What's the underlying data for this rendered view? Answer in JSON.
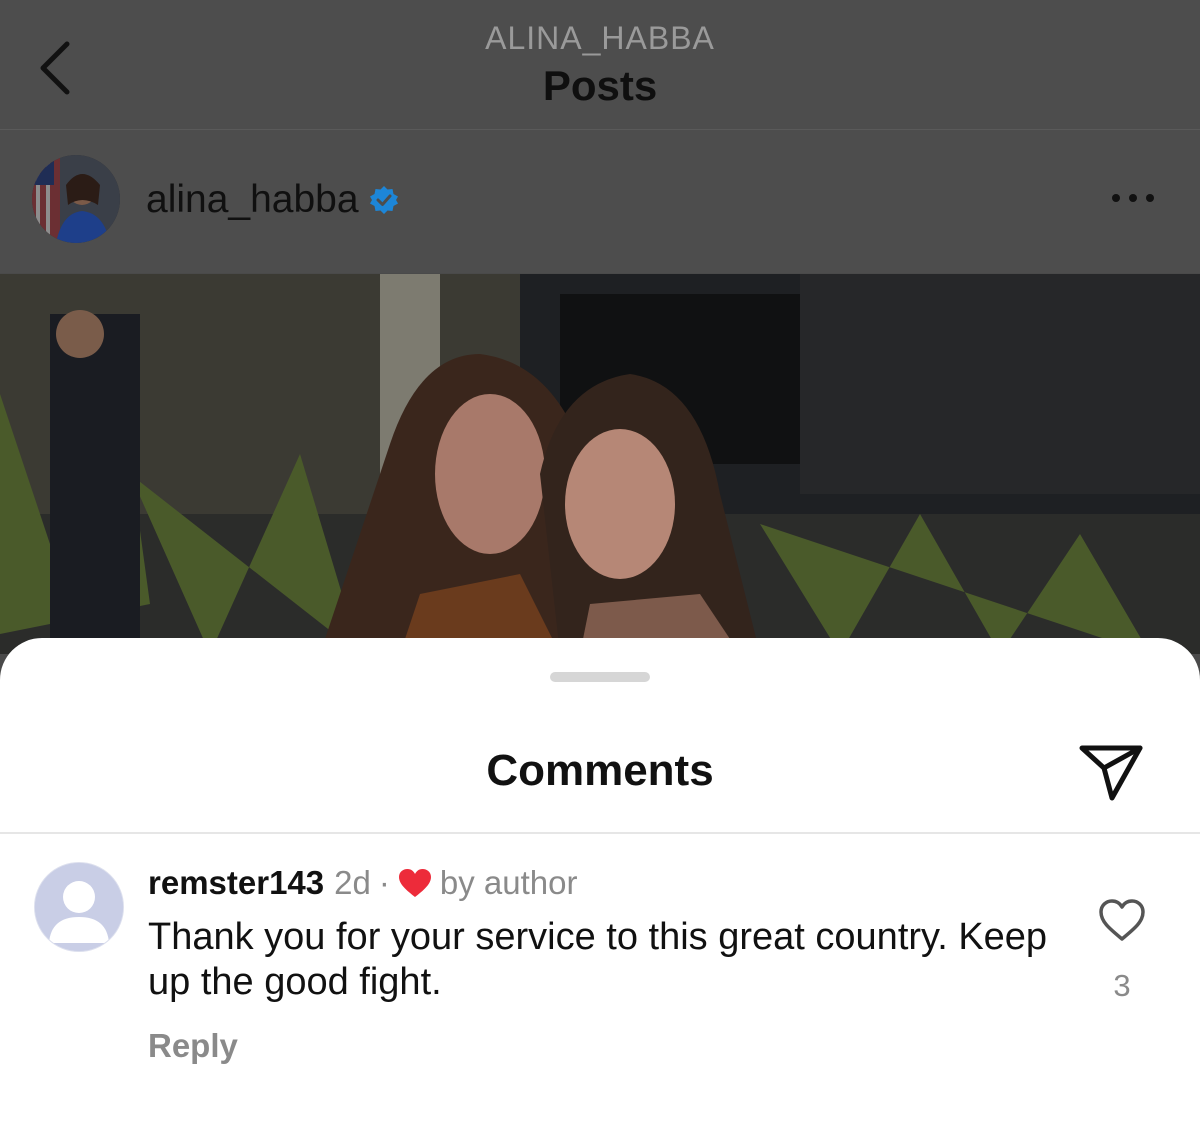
{
  "header": {
    "account": "ALINA_HABBA",
    "title": "Posts"
  },
  "post": {
    "author": "alina_habba",
    "verified": true,
    "image_description": "photo"
  },
  "comments_sheet": {
    "title": "Comments",
    "comments": [
      {
        "username": "remster143",
        "time": "2d",
        "separator": "·",
        "liked_label": "by author",
        "text": "Thank you for your service to this great country. Keep up the good fight.",
        "reply_label": "Reply",
        "like_count": "3"
      }
    ]
  },
  "colors": {
    "liked_heart": "#ed2b3a",
    "verified_badge": "#1d86d8",
    "sheet_bg": "#ffffff",
    "dim_overlay": "#4d4d4d"
  },
  "icons": [
    "chevron-left-icon",
    "verified-icon",
    "more-icon",
    "share-icon",
    "heart-filled-icon",
    "heart-outline-icon",
    "avatar-placeholder-icon"
  ]
}
